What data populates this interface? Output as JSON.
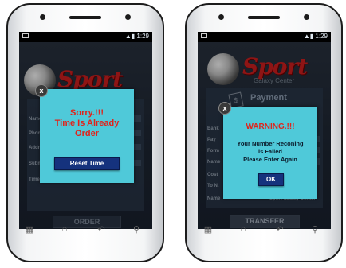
{
  "status": {
    "time": "1:29"
  },
  "left": {
    "logo": "Sport",
    "fields": [
      "Name",
      "Phone",
      "Address",
      "Submit",
      "Time"
    ],
    "dialog": {
      "line1": "Sorry.!!!",
      "line2": "Time Is Already",
      "line3": "Order",
      "button": "Reset Time"
    },
    "bottom_button": "ORDER"
  },
  "right": {
    "logo": "Sport",
    "logo_sub": "Galaxy Center",
    "header": "Payment",
    "fields": [
      "Bank",
      "Pay",
      "Form",
      "Name",
      "Cost",
      "To N.",
      "Name"
    ],
    "name_value": "Sport Galaxy Center",
    "dialog": {
      "title": "WARNING.!!!",
      "line1": "Your Number Reconing",
      "line2": "is Failed",
      "line3": "Please Enter Again",
      "button": "OK"
    },
    "bottom_button": "TRANSFER"
  },
  "close_label": "x",
  "nav_icons": [
    "recent-apps-icon",
    "home-icon",
    "back-icon",
    "search-icon"
  ],
  "colors": {
    "dialog_bg": "#4fc9d9",
    "alert_red": "#e0231b",
    "button_blue": "#15327d",
    "logo_red": "#d21f1f"
  }
}
